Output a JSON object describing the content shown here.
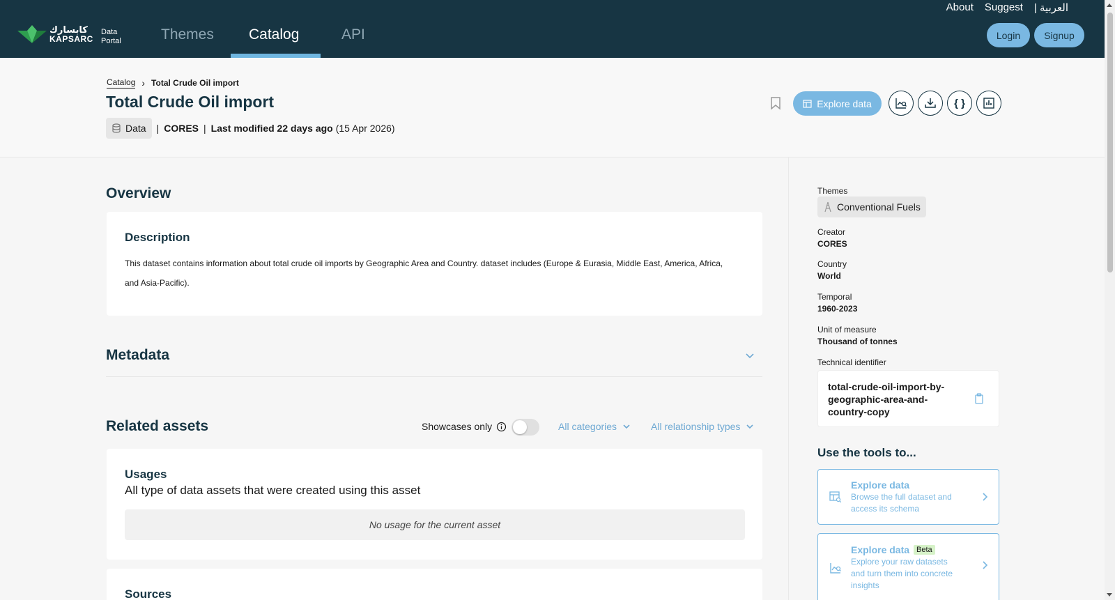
{
  "header": {
    "logo_arabic": "كابسارك",
    "logo_english": "KAPSARC",
    "logo_portal": "Data Portal",
    "nav": [
      {
        "label": "Themes"
      },
      {
        "label": "Catalog"
      },
      {
        "label": "API"
      }
    ],
    "top_links": [
      "About",
      "Suggest",
      "| العربية"
    ],
    "login_label": "Login",
    "signup_label": "Signup",
    "brand_color": "#173543",
    "accent_color": "#7ab8e2"
  },
  "breadcrumb": {
    "parent": "Catalog",
    "current": "Total Crude Oil import"
  },
  "asset": {
    "title": "Total Crude Oil import",
    "type": "Data",
    "source": "CORES",
    "modified_label": "Last modified 22 days ago",
    "modified_date": "(15 Apr 2026)",
    "explore_label": "Explore data"
  },
  "overview": {
    "heading": "Overview",
    "description_heading": "Description",
    "description": "This dataset contains information about total crude oil imports by Geographic Area and Country. dataset includes (Europe & Eurasia, Middle East, America, Africa, and Asia-Pacific)."
  },
  "metadata": {
    "heading": "Metadata"
  },
  "related": {
    "heading": "Related assets",
    "showcases_label": "Showcases only",
    "showcases_on": false,
    "categories_filter": "All categories",
    "relationship_filter": "All relationship types",
    "usages_heading": "Usages",
    "usages_subtitle": "All type of data assets that were created using this asset",
    "usages_empty": "No usage for the current asset",
    "sources_heading": "Sources"
  },
  "sidebar": {
    "themes_label": "Themes",
    "theme": "Conventional Fuels",
    "creator_label": "Creator",
    "creator": "CORES",
    "country_label": "Country",
    "country": "World",
    "temporal_label": "Temporal",
    "temporal": "1960-2023",
    "unit_label": "Unit of measure",
    "unit": "Thousand of tonnes",
    "tech_label": "Technical identifier",
    "tech_id": "total-crude-oil-import-by-geographic-area-and-country-copy",
    "tools_heading": "Use the tools to...",
    "tools": [
      {
        "title": "Explore data",
        "badge": "",
        "desc": "Browse the full dataset and access its schema"
      },
      {
        "title": "Explore data",
        "badge": "Beta",
        "desc": "Explore your raw datasets and turn them into concrete insights"
      }
    ]
  }
}
